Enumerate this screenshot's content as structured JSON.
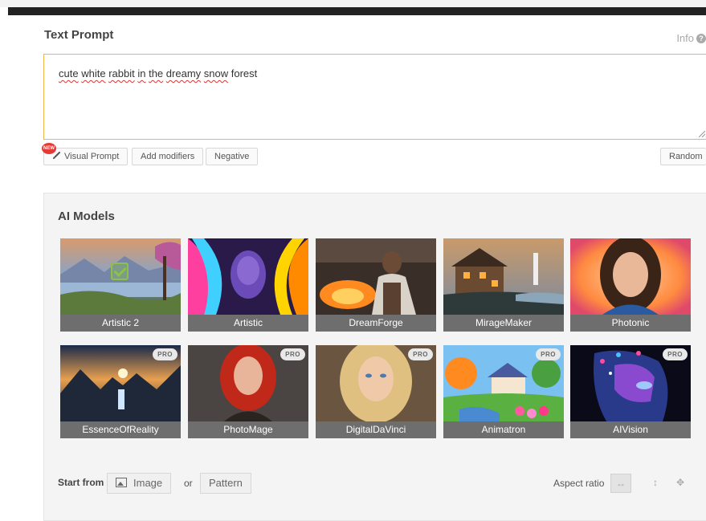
{
  "text_prompt": {
    "title": "Text Prompt",
    "info_label": "Info",
    "value": "cute white rabbit in the dreamy snow forest",
    "words": [
      "cute",
      "white",
      "rabbit",
      "in",
      "the",
      "dreamy",
      "snow",
      "forest"
    ]
  },
  "prompt_buttons": {
    "new_badge": "NEW",
    "visual_prompt": "Visual Prompt",
    "add_modifiers": "Add modifiers",
    "negative": "Negative",
    "random": "Random"
  },
  "ai_models": {
    "title": "AI Models",
    "selected": "Artistic 2",
    "pro_badge": "PRO",
    "items": [
      {
        "name": "Artistic 2",
        "pro": false,
        "selected": true
      },
      {
        "name": "Artistic",
        "pro": false
      },
      {
        "name": "DreamForge",
        "pro": false
      },
      {
        "name": "MirageMaker",
        "pro": false
      },
      {
        "name": "Photonic",
        "pro": false
      },
      {
        "name": "EssenceOfReality",
        "pro": true
      },
      {
        "name": "PhotoMage",
        "pro": true
      },
      {
        "name": "DigitalDaVinci",
        "pro": true
      },
      {
        "name": "Animatron",
        "pro": true
      },
      {
        "name": "AIVision",
        "pro": true
      }
    ]
  },
  "start_from": {
    "label": "Start from",
    "image_button": "Image",
    "or_text": "or",
    "pattern_button": "Pattern"
  },
  "aspect_ratio": {
    "label": "Aspect ratio",
    "options": [
      "landscape",
      "portrait",
      "free"
    ]
  },
  "colors": {
    "prompt_border": "#f0b44a",
    "selected_check": "#8bc34a",
    "label_bar": "#6e6e6e",
    "new_badge": "#e53935"
  }
}
